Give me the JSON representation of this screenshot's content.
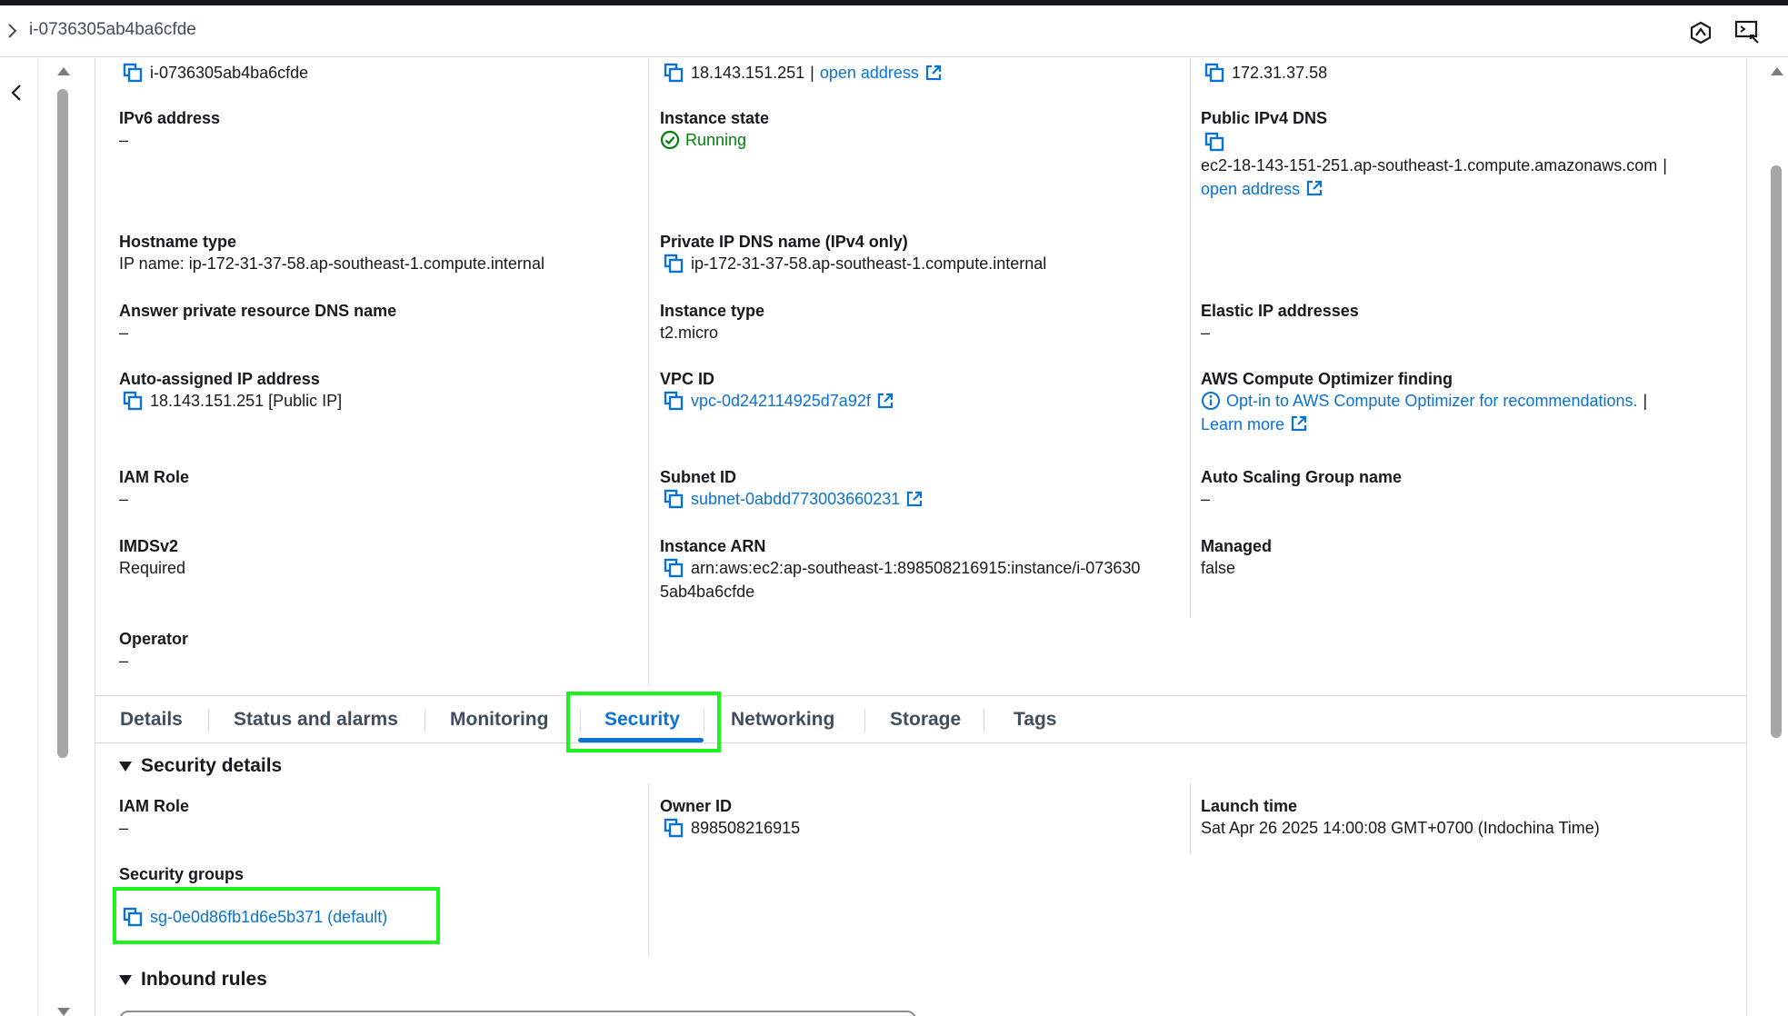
{
  "header": {
    "instance_id": "i-0736305ab4ba6cfde"
  },
  "details": {
    "col1": [
      {
        "key": "instance_id",
        "label": "",
        "value": "i-0736305ab4ba6cfde"
      },
      {
        "key": "ipv6",
        "label": "IPv6 address",
        "value": "–"
      },
      {
        "key": "hostname_type",
        "label": "Hostname type",
        "value": "IP name: ip-172-31-37-58.ap-southeast-1.compute.internal"
      },
      {
        "key": "answer_dns",
        "label": "Answer private resource DNS name",
        "value": "–"
      },
      {
        "key": "auto_ip",
        "label": "Auto-assigned IP address",
        "value": "18.143.151.251 [Public IP]"
      },
      {
        "key": "iam_role",
        "label": "IAM Role",
        "value": "–"
      },
      {
        "key": "imdsv2",
        "label": "IMDSv2",
        "value": "Required"
      },
      {
        "key": "operator",
        "label": "Operator",
        "value": "–"
      }
    ],
    "col2": [
      {
        "key": "public_ip",
        "value": "18.143.151.251",
        "link": "open address"
      },
      {
        "key": "instance_state",
        "label": "Instance state",
        "value": "Running"
      },
      {
        "key": "private_dns",
        "label": "Private IP DNS name (IPv4 only)",
        "value": "ip-172-31-37-58.ap-southeast-1.compute.internal"
      },
      {
        "key": "instance_type",
        "label": "Instance type",
        "value": "t2.micro"
      },
      {
        "key": "vpc_id",
        "label": "VPC ID",
        "value": "vpc-0d242114925d7a92f"
      },
      {
        "key": "subnet_id",
        "label": "Subnet ID",
        "value": "subnet-0abdd773003660231"
      },
      {
        "key": "instance_arn",
        "label": "Instance ARN",
        "value_line1": "arn:aws:ec2:ap-southeast-1:898508216915:instance/i-073630",
        "value_line2": "5ab4ba6cfde"
      }
    ],
    "col3": [
      {
        "key": "private_ip",
        "value": "172.31.37.58"
      },
      {
        "key": "public_dns",
        "label": "Public IPv4 DNS",
        "value": "ec2-18-143-151-251.ap-southeast-1.compute.amazonaws.com",
        "pipe": "|",
        "link": "open address"
      },
      {
        "key": "elastic_ip",
        "label": "Elastic IP addresses",
        "value": "–"
      },
      {
        "key": "optimizer",
        "label": "AWS Compute Optimizer finding",
        "value": "Opt-in to AWS Compute Optimizer for recommendations.",
        "pipe": "|",
        "link": "Learn more"
      },
      {
        "key": "asg",
        "label": "Auto Scaling Group name",
        "value": "–"
      },
      {
        "key": "managed",
        "label": "Managed",
        "value": "false"
      }
    ]
  },
  "tabs": [
    "Details",
    "Status and alarms",
    "Monitoring",
    "Security",
    "Networking",
    "Storage",
    "Tags"
  ],
  "active_tab": "Security",
  "security": {
    "heading": "Security details",
    "iam_role": {
      "label": "IAM Role",
      "value": "–"
    },
    "owner_id": {
      "label": "Owner ID",
      "value": "898508216915"
    },
    "launch_time": {
      "label": "Launch time",
      "value": "Sat Apr 26 2025 14:00:08 GMT+0700 (Indochina Time)"
    },
    "security_groups": {
      "label": "Security groups",
      "value": "sg-0e0d86fb1d6e5b371 (default)"
    },
    "inbound_heading": "Inbound rules"
  },
  "colors": {
    "link": "#0972d3",
    "success": "#037f0c",
    "highlight": "#1cf21c",
    "text": "#16191f"
  },
  "icons": [
    "chevron-right-icon",
    "chevron-left-icon",
    "copy-icon",
    "external-link-icon",
    "success-check-icon",
    "info-icon",
    "settings-hex-icon",
    "cloudshell-icon",
    "caret-down-icon"
  ]
}
